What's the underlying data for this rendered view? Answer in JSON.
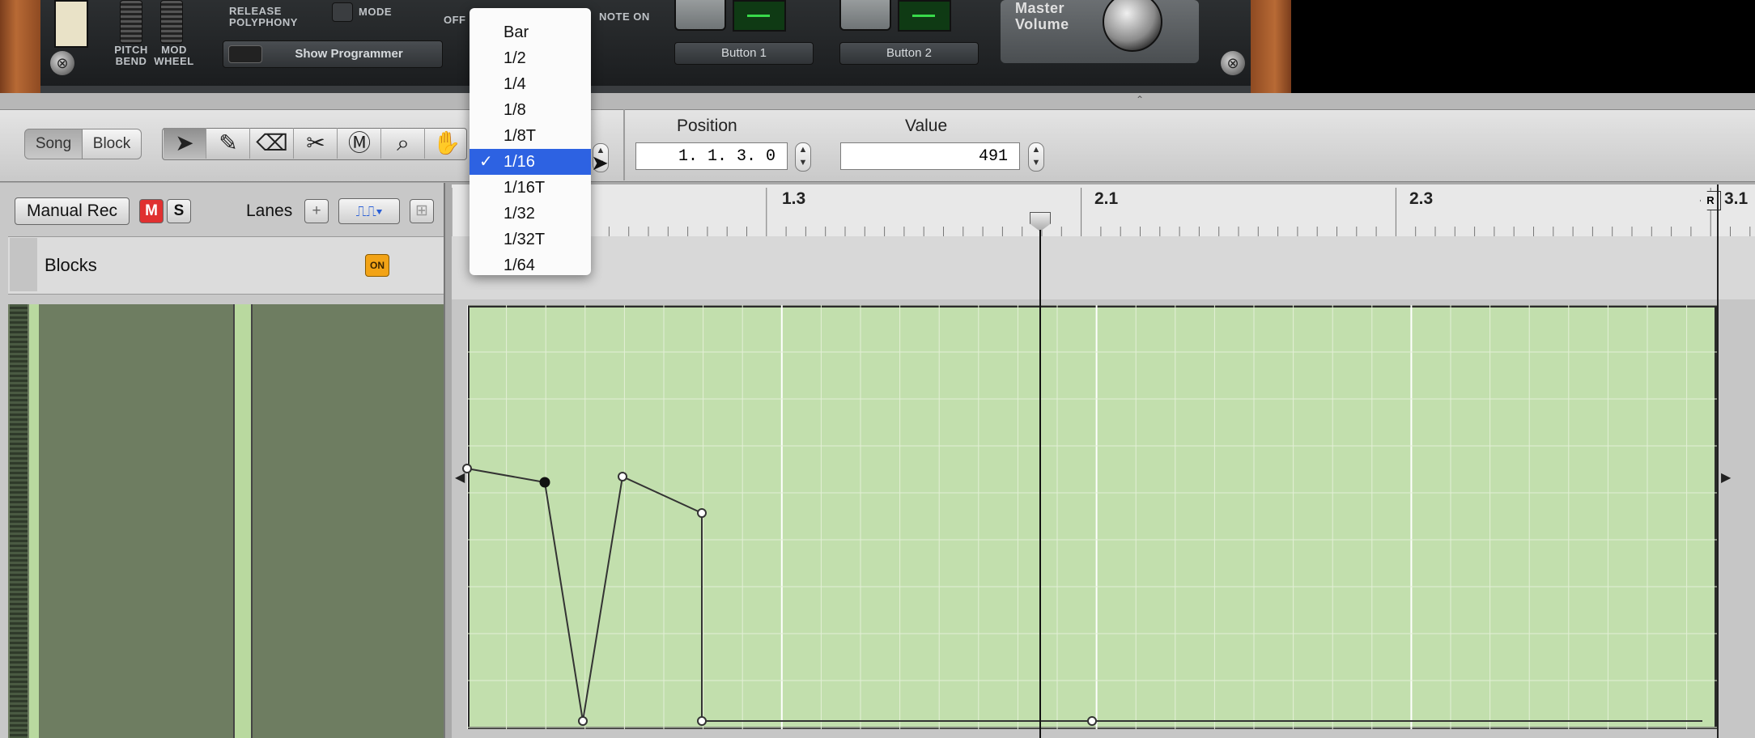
{
  "device": {
    "pitch_bend": "PITCH\nBEND",
    "mod_wheel": "MOD\nWHEEL",
    "release_polyphony": "RELEASE\nPOLYPHONY",
    "mode": "MODE",
    "off": "OFF",
    "note_on": "NOTE ON",
    "show_programmer": "Show Programmer",
    "button1": "Button 1",
    "button2": "Button 2",
    "master_volume": "Master\nVolume"
  },
  "toolbar": {
    "song": "Song",
    "block": "Block",
    "position_label": "Position",
    "position_value": "1. 1. 3.   0",
    "value_label": "Value",
    "value_value": "491"
  },
  "tools": [
    "select-arrow",
    "pencil",
    "eraser",
    "razor",
    "mute",
    "magnify",
    "hand"
  ],
  "tracklist": {
    "manual_rec": "Manual Rec",
    "mute": "M",
    "solo": "S",
    "lanes": "Lanes",
    "add_lane": "+",
    "blocks": "Blocks",
    "on_badge": "ON"
  },
  "ruler": {
    "marks": [
      "1.3",
      "2.1",
      "2.3",
      "3.1"
    ],
    "right_locator": "R"
  },
  "menu": {
    "items": [
      "Bar",
      "1/2",
      "1/4",
      "1/8",
      "1/8T",
      "1/16",
      "1/16T",
      "1/32",
      "1/32T",
      "1/64"
    ],
    "selected": "1/16",
    "check": "✓"
  },
  "automation": {
    "points_bars": [
      {
        "pos": "1.1.1.0",
        "value": 491
      },
      {
        "pos": "1.1.2.0",
        "value": 470
      },
      {
        "pos": "1.1.3.0",
        "value": 0
      },
      {
        "pos": "1.1.4.0",
        "value": 485
      }
    ]
  }
}
